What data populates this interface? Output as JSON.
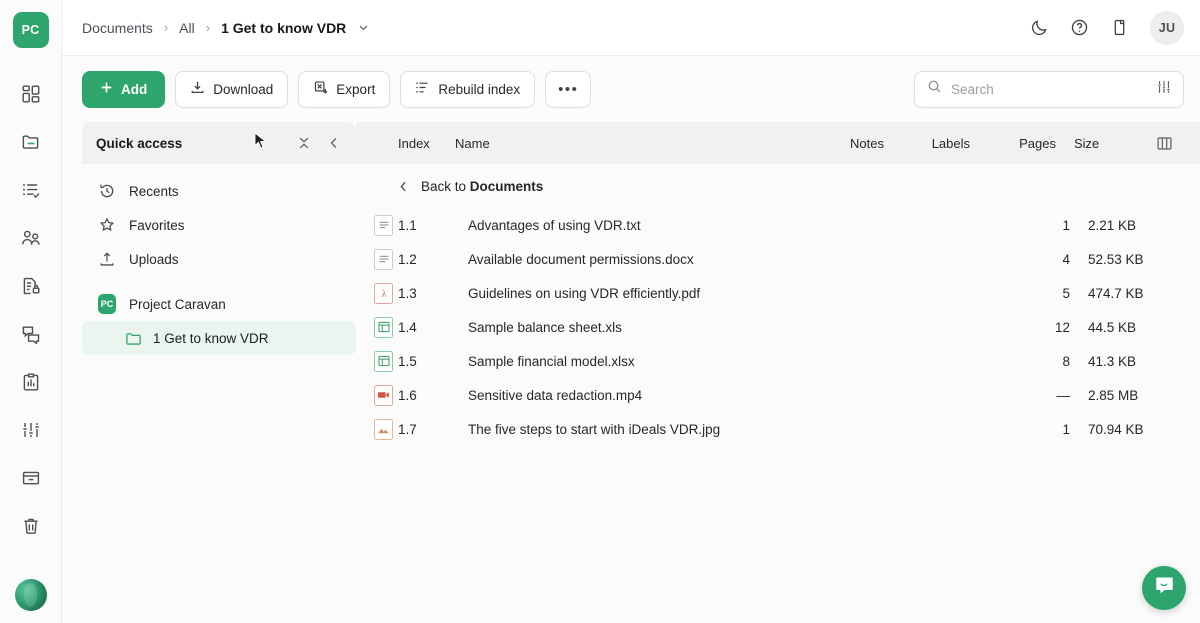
{
  "app": {
    "logo_initials": "PC",
    "accent_color": "#2ea56c",
    "selected_row_bg": "#e9f5ee"
  },
  "rail": {
    "items": [
      {
        "name": "dashboard-icon",
        "label": "Dashboard"
      },
      {
        "name": "documents-icon",
        "label": "Documents"
      },
      {
        "name": "checklist-icon",
        "label": "Checklists"
      },
      {
        "name": "users-icon",
        "label": "Users"
      },
      {
        "name": "document-lock-icon",
        "label": "Permissions"
      },
      {
        "name": "comments-icon",
        "label": "Q&A"
      },
      {
        "name": "reports-icon",
        "label": "Reports"
      },
      {
        "name": "settings-sliders-icon",
        "label": "Settings"
      },
      {
        "name": "archive-icon",
        "label": "Archive"
      },
      {
        "name": "trash-icon",
        "label": "Trash"
      }
    ],
    "user_avatar": "user-avatar"
  },
  "header": {
    "breadcrumbs": [
      {
        "label": "Documents",
        "current": false
      },
      {
        "label": "All",
        "current": false
      },
      {
        "label": "1 Get to know VDR",
        "current": true
      }
    ],
    "separator": "›",
    "actions": [
      {
        "name": "dark-mode-icon",
        "label": "Dark mode"
      },
      {
        "name": "help-icon",
        "label": "Help"
      },
      {
        "name": "panel-icon",
        "label": "Panel"
      }
    ],
    "user_initials": "JU"
  },
  "toolbar": {
    "add_label": "Add",
    "download_label": "Download",
    "export_label": "Export",
    "rebuild_index_label": "Rebuild index",
    "more_label": "•••"
  },
  "search": {
    "placeholder": "Search",
    "value": "",
    "filter_icon": "filter-sliders-icon"
  },
  "quick_access": {
    "title": "Quick access",
    "collapse_all_icon": "collapse-all-icon",
    "collapse_panel_icon": "chevron-left-icon",
    "items": [
      {
        "label": "Recents",
        "icon": "history-icon"
      },
      {
        "label": "Favorites",
        "icon": "star-icon"
      },
      {
        "label": "Uploads",
        "icon": "upload-icon"
      }
    ],
    "project": {
      "label": "Project Caravan",
      "badge": "PC"
    },
    "child": {
      "label": "1 Get to know VDR",
      "icon": "folder-icon",
      "selected": true
    }
  },
  "table": {
    "columns": [
      "Index",
      "Name",
      "Notes",
      "Labels",
      "Pages",
      "Size"
    ],
    "columns_icon": "columns-icon",
    "back_prefix": "Back to",
    "back_target": "Documents",
    "rows": [
      {
        "index": "1.1",
        "name": "Advantages of using VDR.txt",
        "notes": "",
        "labels": "",
        "pages": "1",
        "size": "2.21 KB",
        "type": "txt"
      },
      {
        "index": "1.2",
        "name": "Available document permissions.docx",
        "notes": "",
        "labels": "",
        "pages": "4",
        "size": "52.53 KB",
        "type": "docx"
      },
      {
        "index": "1.3",
        "name": "Guidelines on using VDR efficiently.pdf",
        "notes": "",
        "labels": "",
        "pages": "5",
        "size": "474.7 KB",
        "type": "pdf"
      },
      {
        "index": "1.4",
        "name": "Sample balance sheet.xls",
        "notes": "",
        "labels": "",
        "pages": "12",
        "size": "44.5 KB",
        "type": "xls"
      },
      {
        "index": "1.5",
        "name": "Sample financial model.xlsx",
        "notes": "",
        "labels": "",
        "pages": "8",
        "size": "41.3 KB",
        "type": "xls"
      },
      {
        "index": "1.6",
        "name": "Sensitive data redaction.mp4",
        "notes": "",
        "labels": "",
        "pages": "—",
        "size": "2.85 MB",
        "type": "mp4"
      },
      {
        "index": "1.7",
        "name": "The five steps to start with iDeals VDR.jpg",
        "notes": "",
        "labels": "",
        "pages": "1",
        "size": "70.94 KB",
        "type": "jpg"
      }
    ]
  },
  "chat": {
    "icon": "chat-bubble-icon",
    "label": "Open chat"
  }
}
